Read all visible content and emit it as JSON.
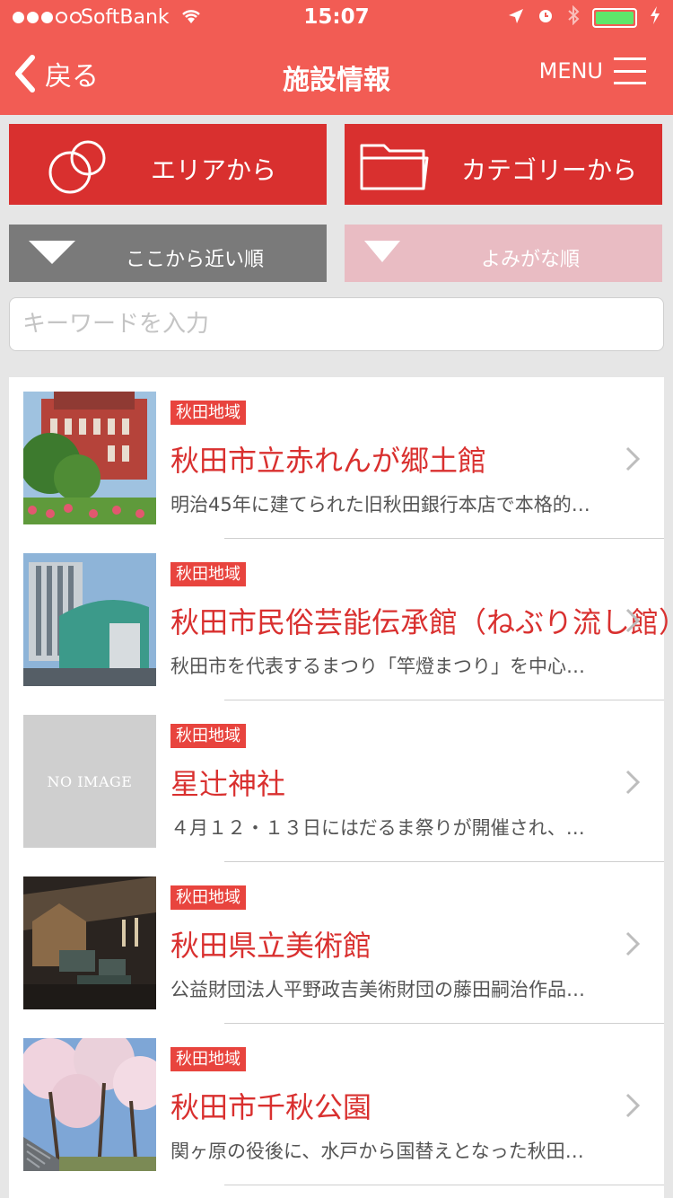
{
  "status_bar": {
    "carrier": "SoftBank",
    "time": "15:07"
  },
  "nav": {
    "back_label": "戻る",
    "title": "施設情報",
    "menu_label": "MENU"
  },
  "filters": {
    "area_label": "エリアから",
    "category_label": "カテゴリーから"
  },
  "sort": {
    "near_label": "ここから近い順",
    "yomi_label": "よみがな順"
  },
  "search": {
    "placeholder": "キーワードを入力"
  },
  "items": [
    {
      "badge": "秋田地域",
      "title": "秋田市立赤れんが郷土館",
      "desc": "明治45年に建てられた旧秋田銀行本店で本格的…"
    },
    {
      "badge": "秋田地域",
      "title": "秋田市民俗芸能伝承館（ねぶり流し館）",
      "desc": "秋田市を代表するまつり「竿燈まつり」を中心…"
    },
    {
      "badge": "秋田地域",
      "title": "星辻神社",
      "desc": "４月１２・１３日にはだるま祭りが開催され、…",
      "no_image": "NO IMAGE"
    },
    {
      "badge": "秋田地域",
      "title": "秋田県立美術館",
      "desc": "公益財団法人平野政吉美術財団の藤田嗣治作品…"
    },
    {
      "badge": "秋田地域",
      "title": "秋田市千秋公園",
      "desc": "関ヶ原の役後に、水戸から国替えとなった秋田…"
    }
  ],
  "colors": {
    "header": "#f25c54",
    "primary_button": "#d9302f",
    "sort_active": "#7a7a7a",
    "sort_inactive": "#e9bcc3",
    "badge": "#e8443e"
  }
}
